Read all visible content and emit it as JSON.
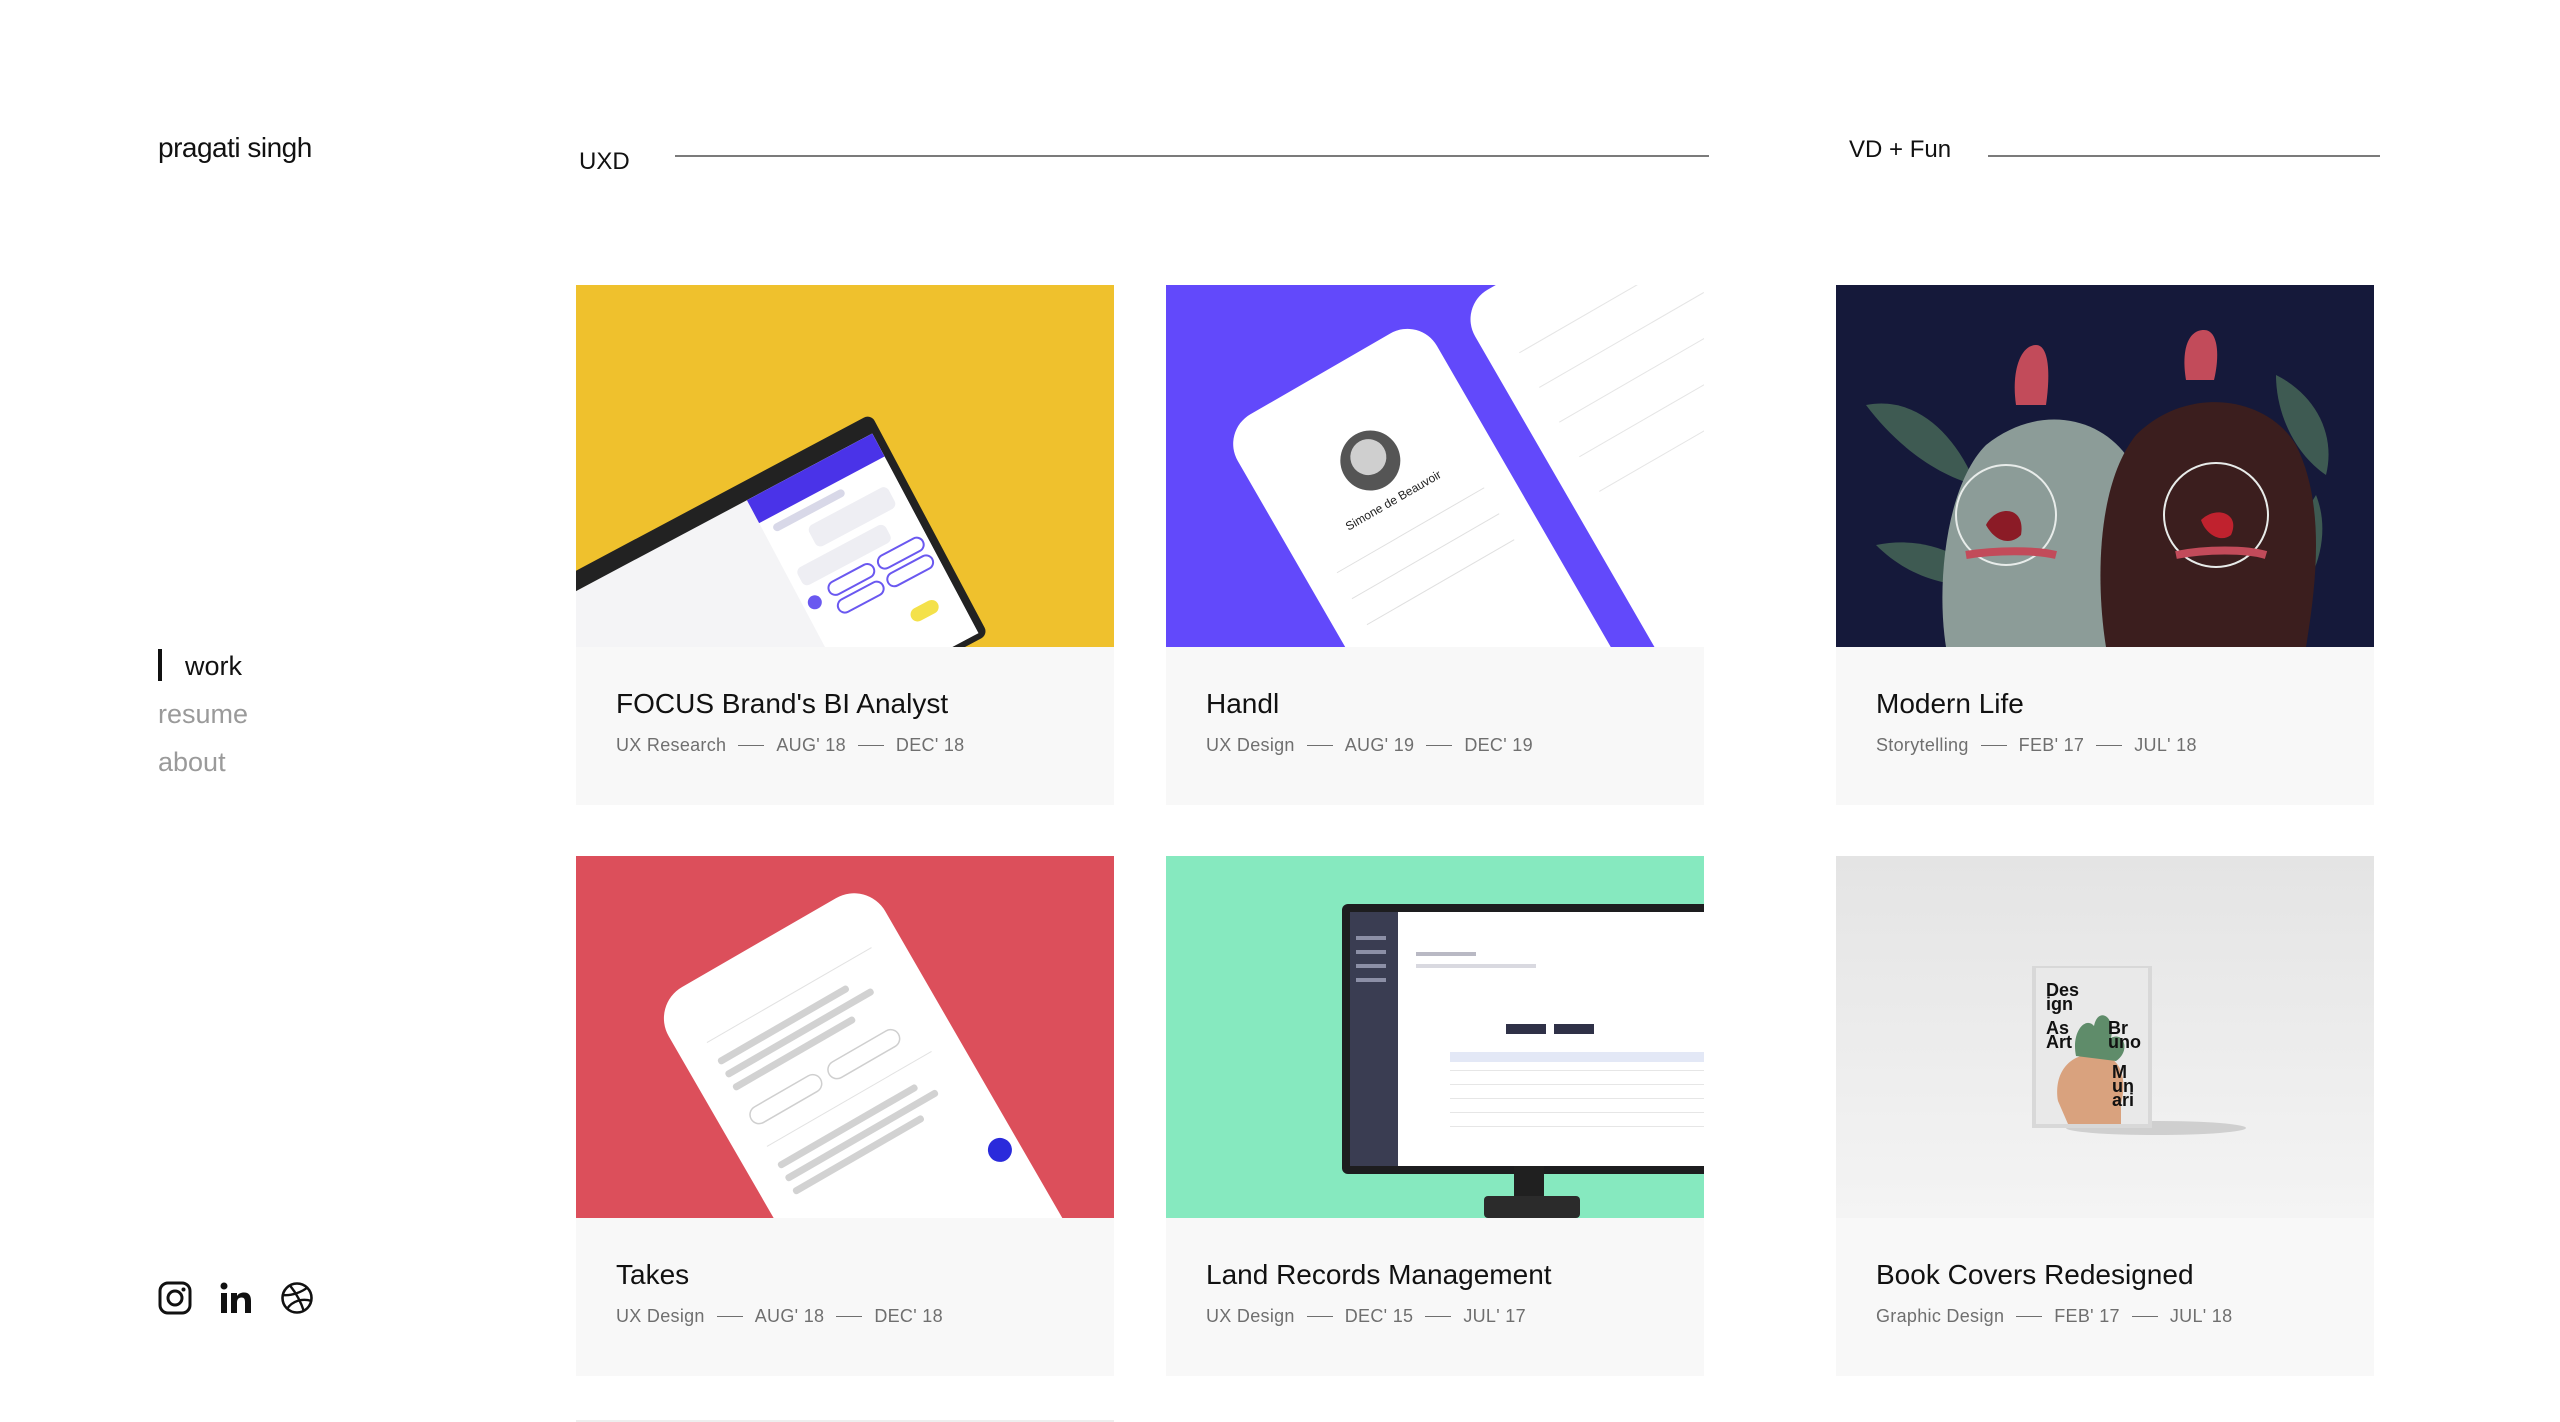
{
  "site": {
    "logo": "pragati singh"
  },
  "nav": {
    "items": [
      {
        "label": "work",
        "active": true
      },
      {
        "label": "resume",
        "active": false
      },
      {
        "label": "about",
        "active": false
      }
    ]
  },
  "social": [
    {
      "icon": "instagram-icon"
    },
    {
      "icon": "linkedin-icon"
    },
    {
      "icon": "dribbble-icon"
    }
  ],
  "sections": {
    "uxd": "UXD",
    "vd": "VD + Fun"
  },
  "projects": [
    {
      "title": "FOCUS Brand's BI Analyst",
      "category": "UX Research",
      "start": "AUG' 18",
      "end": "DEC' 18",
      "thumb_color": "#efc12d"
    },
    {
      "title": "Handl",
      "category": "UX Design",
      "start": "AUG' 19",
      "end": "DEC' 19",
      "thumb_color": "#6249fb"
    },
    {
      "title": "Modern Life",
      "category": "Storytelling",
      "start": "FEB' 17",
      "end": "JUL' 18",
      "thumb_color": "#15193a"
    },
    {
      "title": "Takes",
      "category": "UX Design",
      "start": "AUG' 18",
      "end": "DEC' 18",
      "thumb_color": "#dc4f5b"
    },
    {
      "title": "Land Records Management",
      "category": "UX Design",
      "start": "DEC' 15",
      "end": "JUL' 17",
      "thumb_color": "#86e9bf"
    },
    {
      "title": "Book Covers Redesigned",
      "category": "Graphic Design",
      "start": "FEB' 17",
      "end": "JUL' 18",
      "thumb_color": "#e9e9e9"
    }
  ],
  "thumb_text": {
    "handl_name": "Simone de Beauvoir",
    "book_cover": [
      "Des",
      "ign",
      "As",
      "Art",
      "Br",
      "uno",
      "M",
      "un",
      "ari"
    ]
  }
}
